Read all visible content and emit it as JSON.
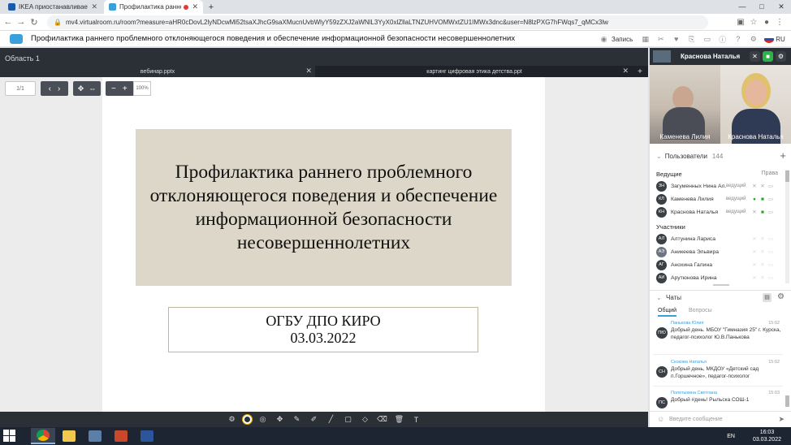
{
  "browser": {
    "tabs": [
      {
        "title": "IKEA приостанавливает деятельн...",
        "active": false,
        "favicon_color": "#1a5aa8"
      },
      {
        "title": "Профилактика раннего про",
        "active": true,
        "favicon_color": "#3aa0dc"
      }
    ],
    "new_tab_label": "+",
    "url": "mv4.virtualroom.ru/room?measure=aHR0cDovL2lyNDcwMi52tsaXJhcG9saXMucnUvbWlyY59zZXJ2aWNlL3YyX0xlZllaLTNZUHVOMWxtZU1IMWx3dnc&user=N8lzPXG7hFWqs7_qMCx3lw",
    "window_controls": [
      "—",
      "□",
      "✕"
    ]
  },
  "app": {
    "title": "Профилактика раннего проблемного отклоняющегося поведения и обеспечение информационной безопасности несовершеннолетних",
    "record_label": "Запись",
    "lang": "RU",
    "accent": "#3aa0dc"
  },
  "workspace": {
    "area_label": "Область 1",
    "doc_tabs": [
      {
        "name": "вебинар.pptx",
        "active": true
      },
      {
        "name": "картинг цифровая этика детства.ppt",
        "active": false
      }
    ],
    "page_indicator": "1/1",
    "zoom": "100%",
    "slide": {
      "title": "Профилактика раннего проблемного отклоняющегося поведения и обеспечение информационной безопасности несовершеннолетних",
      "org": "ОГБУ ДПО КИРО",
      "date": "03.03.2022"
    }
  },
  "panel": {
    "current_user": "Краснова Наталья",
    "video": [
      {
        "name": "Каменева Лилия"
      },
      {
        "name": "Краснова Наталья"
      }
    ],
    "users_label": "Пользователи",
    "users_count": "144",
    "hosts_label": "Ведущие",
    "rights_label": "Права",
    "hosts": [
      {
        "initials": "ЗН",
        "name": "Загуменных Нина Ал...",
        "role": "ведущий"
      },
      {
        "initials": "КЛ",
        "name": "Каменева Лилия",
        "role": "ведущий"
      },
      {
        "initials": "КН",
        "name": "Краснова Наталья",
        "role": "ведущий"
      }
    ],
    "participants_label": "Участники",
    "participants": [
      {
        "initials": "АЛ",
        "name": "Алтунина Лариса"
      },
      {
        "initials": "АЭ",
        "name": "Аникеева Эльвира"
      },
      {
        "initials": "АГ",
        "name": "Анохина Галина"
      },
      {
        "initials": "АИ",
        "name": "Арутюнова Ирина"
      }
    ],
    "chats_label": "Чаты",
    "chat_tabs": [
      "Общий",
      "Вопросы"
    ],
    "messages": [
      {
        "initials": "ПЮ",
        "author": "Панькова Юлия",
        "time": "15:02",
        "text": "Добрый день. МБОУ \"Гимназия 25\" г. Курска, педагог-психолог Ю.В.Панькова"
      },
      {
        "initials": "СН",
        "author": "Скокова Наталья",
        "time": "15:02",
        "text": "Добрый день, МКДОУ «Детский сад п.Горшечное», педагог-психолог"
      },
      {
        "initials": "ПС",
        "author": "Полетыкина Светлана",
        "time": "15:03",
        "text": "Добрый #день! Рыльска СОШ-1"
      }
    ],
    "input_placeholder": "Введите сообщение"
  },
  "taskbar": {
    "lang": "EN",
    "time": "16:03",
    "date": "03.03.2022"
  }
}
